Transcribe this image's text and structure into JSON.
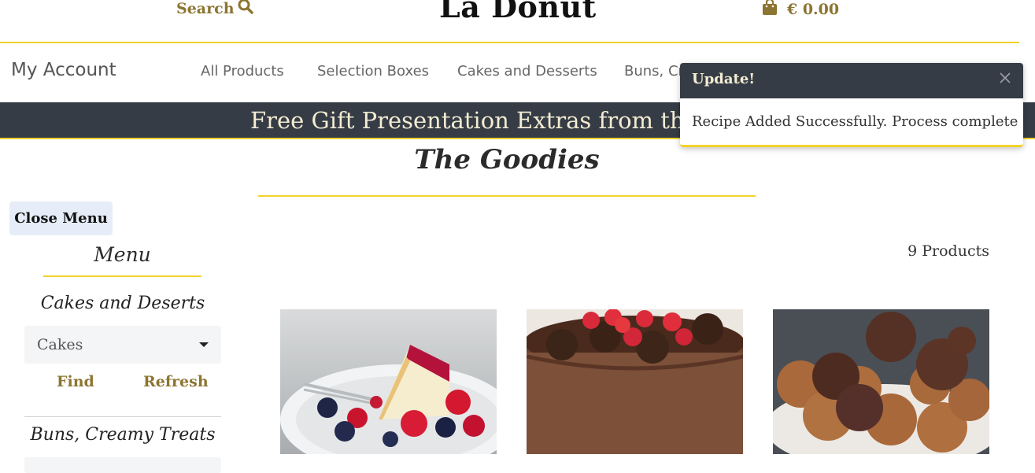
{
  "header": {
    "search_label": "Search",
    "brand": "La Donut",
    "cart_total": "€ 0.00"
  },
  "nav": {
    "my_account": "My Account",
    "items": [
      {
        "label": "All Products"
      },
      {
        "label": "Selection Boxes"
      },
      {
        "label": "Cakes and Desserts"
      },
      {
        "label": "Buns, Cr"
      }
    ]
  },
  "promo": {
    "text": "Free Gift Presentation Extras from the C"
  },
  "section": {
    "title": "The Goodies"
  },
  "sidebar": {
    "close_label": "Close Menu",
    "menu_title": "Menu",
    "categories": [
      {
        "title": "Cakes and Deserts",
        "selected": "Cakes",
        "find_label": "Find",
        "refresh_label": "Refresh"
      },
      {
        "title": "Buns, Creamy Treats"
      }
    ]
  },
  "products": {
    "count_label": "9 Products",
    "items": [
      {
        "image": "raspberry-cheesecake-image"
      },
      {
        "image": "chocolate-truffle-cake-image"
      },
      {
        "image": "chocolate-cookies-image"
      }
    ]
  },
  "toast": {
    "title": "Update!",
    "message": "Recipe Added Successfully. Process complete"
  },
  "colors": {
    "accent_gold": "#f2d22a",
    "link_brown": "#8c7531",
    "dark_banner": "#353c45",
    "banner_text": "#f4ecd2"
  }
}
